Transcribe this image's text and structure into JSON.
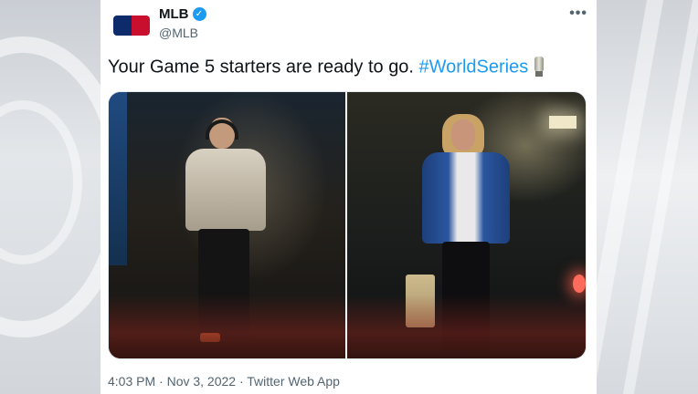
{
  "tweet": {
    "display_name": "MLB",
    "handle": "@MLB",
    "verified_mark": "✓",
    "more_label": "•••",
    "text_plain": "Your Game 5 starters are ready to go. ",
    "hashtag": "#WorldSeries",
    "icons": [
      "mlb-logo",
      "verified-badge-icon",
      "more-icon",
      "trophy-icon"
    ],
    "timestamp": "4:03 PM · Nov 3, 2022 · Twitter Web App"
  },
  "colors": {
    "link": "#1d9bf0",
    "text": "#0f1419",
    "muted": "#536471"
  }
}
